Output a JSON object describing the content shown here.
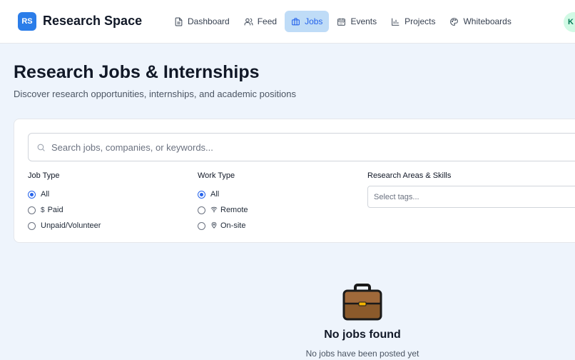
{
  "header": {
    "logo_initials": "RS",
    "brand": "Research Space",
    "nav": [
      {
        "label": "Dashboard",
        "icon": "document-icon",
        "active": false
      },
      {
        "label": "Feed",
        "icon": "users-icon",
        "active": false
      },
      {
        "label": "Jobs",
        "icon": "briefcase-icon",
        "active": true
      },
      {
        "label": "Events",
        "icon": "calendar-icon",
        "active": false
      },
      {
        "label": "Projects",
        "icon": "bar-chart-icon",
        "active": false
      },
      {
        "label": "Whiteboards",
        "icon": "palette-icon",
        "active": false
      }
    ],
    "avatar_initial": "K"
  },
  "page": {
    "title": "Research Jobs & Internships",
    "subtitle": "Discover research opportunities, internships, and academic positions"
  },
  "filters": {
    "search_placeholder": "Search jobs, companies, or keywords...",
    "job_type": {
      "title": "Job Type",
      "options": [
        "All",
        "Paid",
        "Unpaid/Volunteer"
      ],
      "selected": "All",
      "paid_symbol": "$"
    },
    "work_type": {
      "title": "Work Type",
      "options": [
        "All",
        "Remote",
        "On-site"
      ],
      "selected": "All"
    },
    "research_areas": {
      "title": "Research Areas & Skills",
      "placeholder": "Select tags..."
    }
  },
  "empty_state": {
    "icon": "briefcase-emoji",
    "title": "No jobs found",
    "message": "No jobs have been posted yet"
  },
  "colors": {
    "accent": "#2563eb",
    "active_nav_bg": "#bfdcf7",
    "page_bg": "#eef4fc"
  }
}
